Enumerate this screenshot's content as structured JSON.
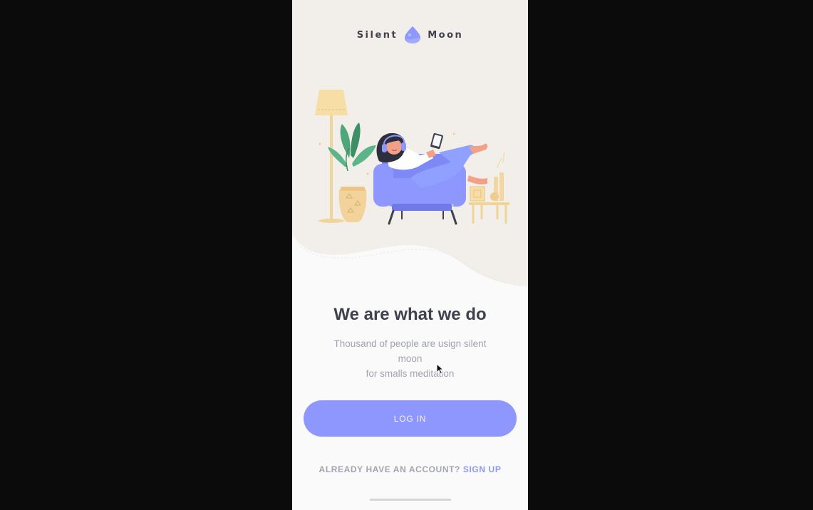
{
  "brand": {
    "left_word": "Silent",
    "right_word": "Moon",
    "logo_icon": "moon-drop-logo"
  },
  "hero": {
    "illustration": "woman-relaxing-in-armchair-illustration"
  },
  "headline": "We are what we do",
  "subtitle": {
    "line1": "Thousand of people are usign silent moon",
    "line2": "for smalls meditation"
  },
  "login_button": {
    "label": "LOG IN"
  },
  "account": {
    "prompt": "ALREADY HAVE AN ACCOUNT?",
    "signup_label": "SIGN UP"
  },
  "colors": {
    "accent": "#8e97fd",
    "heading": "#3f414e",
    "muted": "#a1a4b2",
    "hero_bg": "#f2efea",
    "background": "#fafafa",
    "stage": "#0b0b0c"
  }
}
